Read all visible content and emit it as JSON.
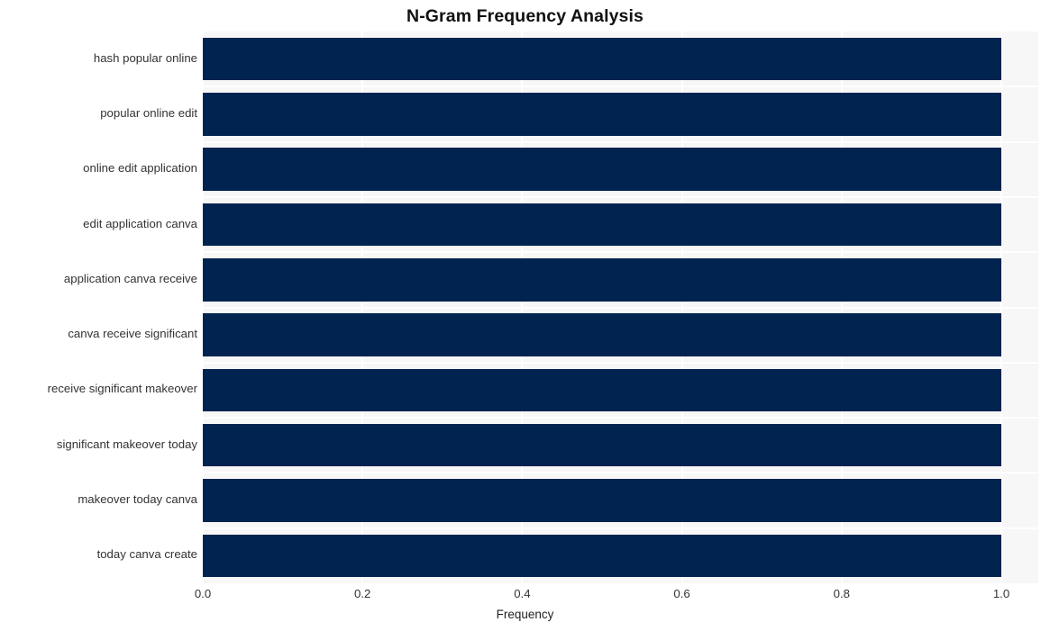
{
  "chart_data": {
    "type": "bar",
    "orientation": "horizontal",
    "title": "N-Gram Frequency Analysis",
    "xlabel": "Frequency",
    "ylabel": "",
    "xlim": [
      0.0,
      1.0
    ],
    "xticks": [
      "0.0",
      "0.2",
      "0.4",
      "0.6",
      "0.8",
      "1.0"
    ],
    "xtick_values": [
      0.0,
      0.2,
      0.4,
      0.6,
      0.8,
      1.0
    ],
    "grid": true,
    "legend": null,
    "bar_color": "#002350",
    "plot_background": "#f7f7f7",
    "figure_background": "#ffffff",
    "categories": [
      "hash popular online",
      "popular online edit",
      "online edit application",
      "edit application canva",
      "application canva receive",
      "canva receive significant",
      "receive significant makeover",
      "significant makeover today",
      "makeover today canva",
      "today canva create"
    ],
    "values": [
      1.0,
      1.0,
      1.0,
      1.0,
      1.0,
      1.0,
      1.0,
      1.0,
      1.0,
      1.0
    ]
  }
}
